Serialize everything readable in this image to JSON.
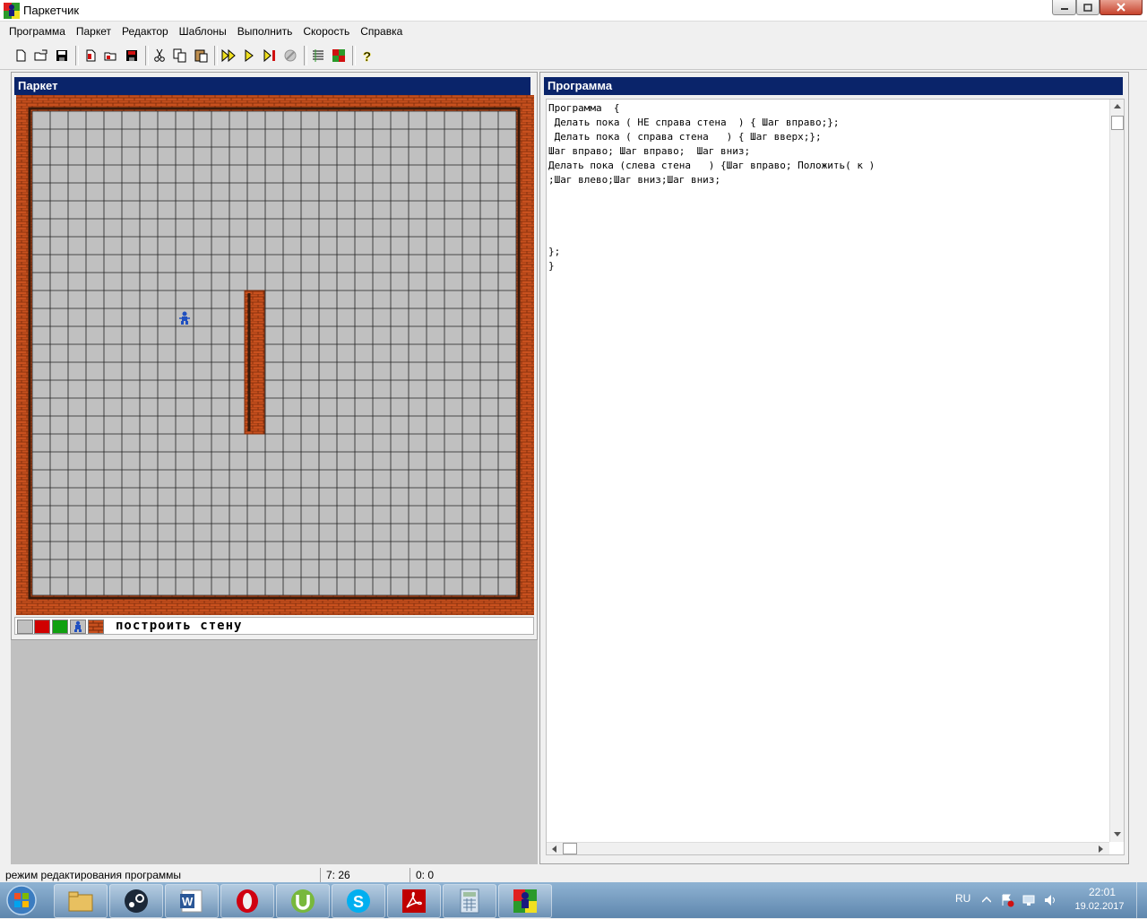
{
  "window": {
    "title": "Паркетчик"
  },
  "menu": [
    "Программа",
    "Паркет",
    "Редактор",
    "Шаблоны",
    "Выполнить",
    "Скорость",
    "Справка"
  ],
  "toolbar": {
    "buttons": [
      "new-file-icon",
      "open-file-icon",
      "save-file-icon",
      "new-program-icon",
      "open-program-icon",
      "save-program-icon",
      "cut-icon",
      "copy-icon",
      "paste-icon",
      "run-fast-icon",
      "run-icon",
      "step-icon",
      "stop-icon",
      "grid-icon",
      "palette-icon",
      "help-icon"
    ]
  },
  "parquet_panel": {
    "title": "Паркет",
    "grid": {
      "cols": 27,
      "rows": 27
    },
    "robot": {
      "col": 8,
      "row": 11
    },
    "walls": [
      {
        "type": "vertical",
        "col": 12,
        "from_row": 10,
        "to_row": 18
      }
    ],
    "legend": {
      "swatches": [
        "empty",
        "red",
        "green",
        "robot",
        "wall"
      ],
      "mode_text": "построить стену"
    }
  },
  "program_panel": {
    "title": "Программа",
    "code": [
      "Программа  {",
      " Делать пока ( НЕ справа стена  ) { Шаг вправо;};",
      " Делать пока ( справа стена   ) { Шаг вверх;};",
      "Шаг вправо; Шаг вправо;  Шаг вниз;",
      "Делать пока (слева стена   ) {Шаг вправо; Положить( к )",
      ";Шаг влево;Шаг вниз;Шаг вниз;",
      "",
      "",
      "",
      "",
      "};",
      "}"
    ]
  },
  "statusbar": {
    "mode": "режим редактирования программы",
    "cursor": "7: 26",
    "coords": "0:  0"
  },
  "taskbar": {
    "apps": [
      "explorer-icon",
      "steam-icon",
      "word-icon",
      "opera-icon",
      "utorrent-icon",
      "skype-icon",
      "acrobat-icon",
      "calculator-icon",
      "parketchik-icon"
    ],
    "lang": "RU",
    "time": "22:01",
    "date": "19.02.2017"
  },
  "colors": {
    "panel_title_bg": "#0a246a",
    "brick": "#c8501e",
    "grid_bg": "#c0c0c0",
    "grid_line": "#202020"
  }
}
